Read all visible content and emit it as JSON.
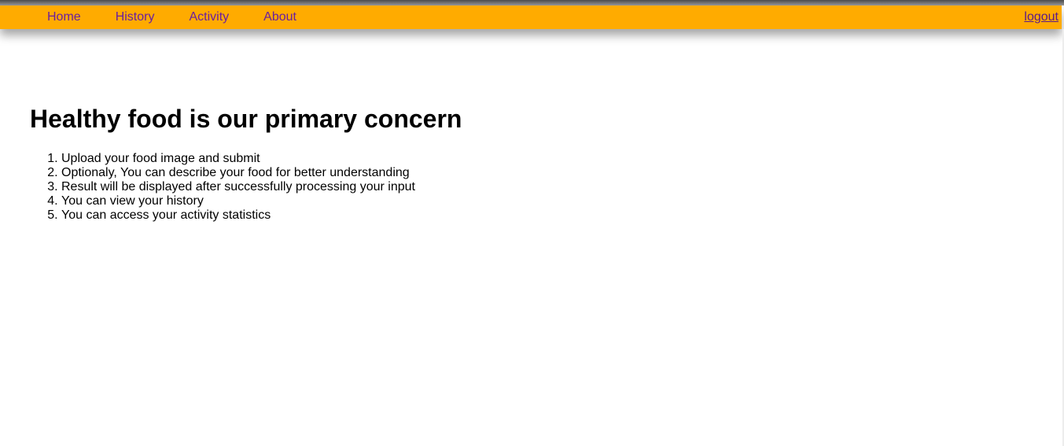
{
  "navbar": {
    "links": [
      {
        "label": "Home"
      },
      {
        "label": "History"
      },
      {
        "label": "Activity"
      },
      {
        "label": "About"
      }
    ],
    "logout_label": "logout",
    "background_color": "#ffab00",
    "link_color": "#6a1fa0"
  },
  "main": {
    "title": "Healthy food is our primary concern",
    "steps": [
      "Upload your food image and submit",
      "Optionaly, You can describe your food for better understanding",
      "Result will be displayed after successfully processing your input",
      "You can view your history",
      "You can access your activity statistics"
    ]
  }
}
